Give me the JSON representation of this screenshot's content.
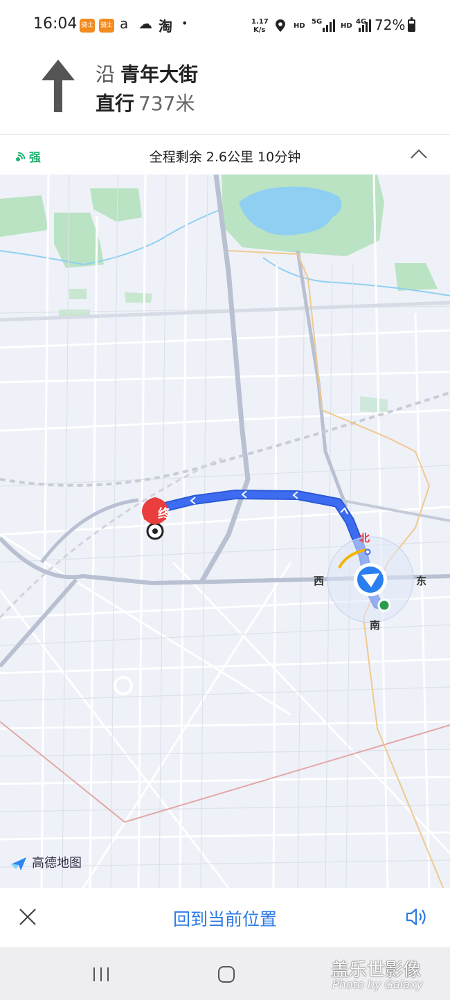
{
  "status_bar": {
    "time": "16:04",
    "app_badge_1": "骑士",
    "app_badge_2": "骑士",
    "app_icon_3": "a",
    "weather_icon": "☁",
    "app_icon_4": "淘",
    "dot": "•",
    "net_speed_value": "1.17",
    "net_speed_unit": "K/s",
    "hd1": "HD",
    "net1": "5G",
    "hd2": "HD",
    "net2": "4G",
    "battery_text": "72%",
    "battery_level": 0.72
  },
  "navigation": {
    "along_word": "沿",
    "road_name": "青年大街",
    "action": "直行",
    "distance": "737米"
  },
  "summary": {
    "signal": "强",
    "remaining": "全程剩余 2.6公里 10分钟"
  },
  "map": {
    "end_marker_label": "终",
    "compass_north": "北",
    "compass_south": "南",
    "compass_west": "西",
    "compass_east": "东",
    "brand_name": "高德地图",
    "route_color": "#3d6cf0"
  },
  "bottom_bar": {
    "recenter_label": "回到当前位置"
  },
  "watermark": {
    "line1": "盖乐世影像",
    "line2": "Photo by Galaxy"
  }
}
